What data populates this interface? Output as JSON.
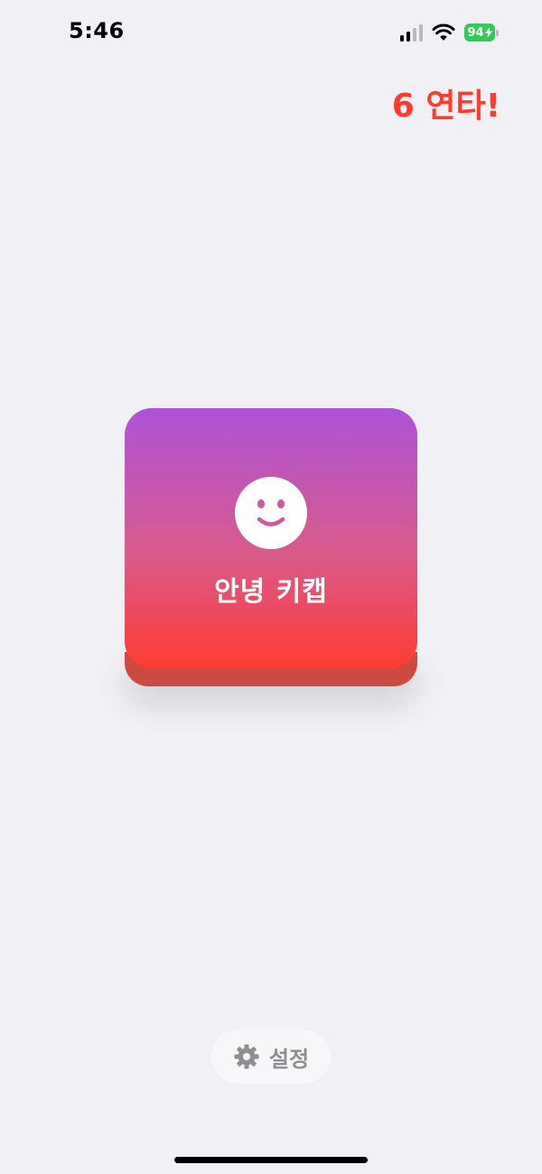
{
  "status_bar": {
    "time": "5:46",
    "battery_level": "94",
    "signal_bars_active": 2,
    "signal_bars_total": 4,
    "icons": [
      "signal-icon",
      "wifi-icon",
      "battery-charging-icon"
    ]
  },
  "combo": {
    "count": "6",
    "label": "연타!",
    "color": "#FF3B30"
  },
  "keycap": {
    "icon": "smile-icon",
    "label": "안녕 키캡",
    "gradient_top": "#AE52D8",
    "gradient_bottom": "#FF3B32",
    "base_color": "#CC4A40"
  },
  "settings": {
    "icon": "gear-icon",
    "label": "설정"
  },
  "colors": {
    "background": "#F1F0F5",
    "battery": "#34C759",
    "settings_text": "#8E8E93"
  }
}
